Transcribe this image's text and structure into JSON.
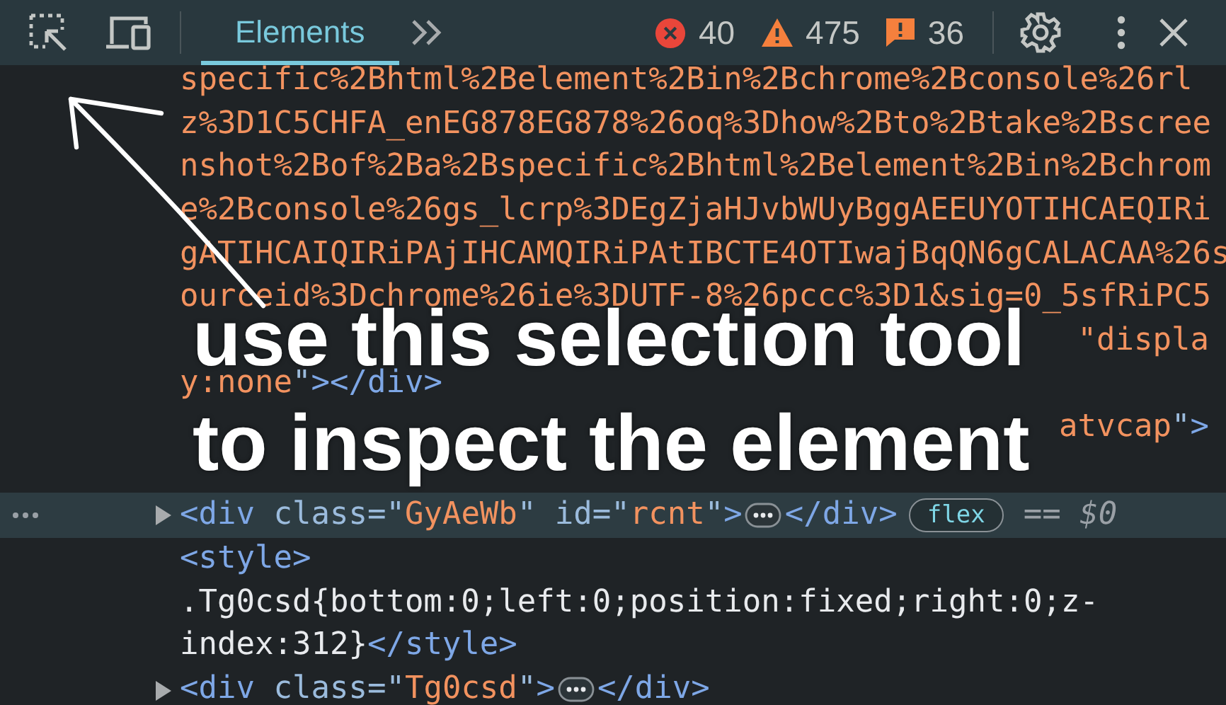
{
  "tabs": [
    {
      "label": "Elements",
      "selected": true
    }
  ],
  "counts": [
    {
      "kind": "error",
      "count": "40"
    },
    {
      "kind": "warning",
      "count": "475"
    },
    {
      "kind": "info",
      "count": "36"
    }
  ],
  "lines": [
    {
      "selected": false,
      "expander": false,
      "parts": [
        {
          "kind": "code",
          "tokens": [
            {
              "kind": "value",
              "t": "specific%2Bhtml%2Belement%2Bin%2Bchrome%2Bconsole%26rl"
            }
          ]
        }
      ]
    },
    {
      "selected": false,
      "expander": false,
      "parts": [
        {
          "kind": "code",
          "tokens": [
            {
              "kind": "value",
              "t": "z%3D1C5CHFA_enEG878EG878%26oq%3Dhow%2Bto%2Btake%2Bscree"
            }
          ]
        }
      ]
    },
    {
      "selected": false,
      "expander": false,
      "parts": [
        {
          "kind": "code",
          "tokens": [
            {
              "kind": "value",
              "t": "nshot%2Bof%2Ba%2Bspecific%2Bhtml%2Belement%2Bin%2Bchrom"
            }
          ]
        }
      ]
    },
    {
      "selected": false,
      "expander": false,
      "parts": [
        {
          "kind": "code",
          "tokens": [
            {
              "kind": "value",
              "t": "e%2Bconsole%26gs_lcrp%3DEgZjaHJvbWUyBggAEEUYOTIHCAEQIRi"
            }
          ]
        }
      ]
    },
    {
      "selected": false,
      "expander": false,
      "parts": [
        {
          "kind": "code",
          "tokens": [
            {
              "kind": "value",
              "t": "gATIHCAIQIRiPAjIHCAMQIRiPAtIBCTE4OTIwajBqQN6gCALACAA%26s"
            }
          ]
        }
      ]
    },
    {
      "selected": false,
      "expander": false,
      "parts": [
        {
          "kind": "code",
          "tokens": [
            {
              "kind": "value",
              "t": "ourceid%3Dchrome%26ie%3DUTF-8%26pccc%3D1&sig=0_5sfRiPC5"
            }
          ]
        }
      ]
    },
    {
      "selected": false,
      "expander": false,
      "covered": true,
      "parts": [
        {
          "kind": "code",
          "tokens": [
            {
              "kind": "value",
              "t": "\"displa"
            }
          ]
        }
      ]
    },
    {
      "selected": false,
      "expander": false,
      "parts": [
        {
          "kind": "code",
          "tokens": [
            {
              "kind": "value",
              "t": "y:none"
            },
            {
              "kind": "attr",
              "t": "\""
            },
            {
              "kind": "tag",
              "t": "></div>"
            }
          ]
        }
      ]
    },
    {
      "selected": false,
      "expander": false,
      "covered": true,
      "parts": [
        {
          "kind": "code",
          "tokens": [
            {
              "kind": "value",
              "t": "atvcap"
            },
            {
              "kind": "attr",
              "t": "\""
            },
            {
              "kind": "tag",
              "t": ">"
            }
          ]
        }
      ]
    },
    {
      "selected": false,
      "expander": false
    },
    {
      "selected": true,
      "expander": true,
      "parts": [
        {
          "kind": "code",
          "tokens": [
            {
              "kind": "tag",
              "t": "<div"
            },
            {
              "kind": "attr",
              "t": " class=\""
            },
            {
              "kind": "value",
              "t": "GyAeWb"
            },
            {
              "kind": "attr",
              "t": "\" id=\""
            },
            {
              "kind": "value",
              "t": "rcnt"
            },
            {
              "kind": "attr",
              "t": "\""
            },
            {
              "kind": "tag",
              "t": ">"
            }
          ]
        },
        {
          "kind": "ellipsis"
        },
        {
          "kind": "code",
          "tokens": [
            {
              "kind": "tag",
              "t": "</div>"
            }
          ]
        },
        {
          "kind": "badge",
          "text": "flex"
        },
        {
          "kind": "ref",
          "text": "== $0"
        }
      ]
    },
    {
      "selected": false,
      "expander": false,
      "parts": [
        {
          "kind": "code",
          "tokens": [
            {
              "kind": "tag",
              "t": "<style>"
            }
          ]
        }
      ]
    },
    {
      "selected": false,
      "expander": false,
      "parts": [
        {
          "kind": "code",
          "tokens": [
            {
              "kind": "text",
              "t": ".Tg0csd{bottom:0;left:0;position:fixed;right:0;z-"
            }
          ]
        }
      ]
    },
    {
      "selected": false,
      "expander": false,
      "parts": [
        {
          "kind": "code",
          "tokens": [
            {
              "kind": "text",
              "t": "index:312}"
            },
            {
              "kind": "tag",
              "t": "</style>"
            }
          ]
        }
      ]
    },
    {
      "selected": false,
      "expander": true,
      "parts": [
        {
          "kind": "code",
          "tokens": [
            {
              "kind": "tag",
              "t": "<div"
            },
            {
              "kind": "attr",
              "t": " class=\""
            },
            {
              "kind": "value",
              "t": "Tg0csd"
            },
            {
              "kind": "attr",
              "t": "\""
            },
            {
              "kind": "tag",
              "t": ">"
            }
          ]
        },
        {
          "kind": "ellipsis"
        },
        {
          "kind": "code",
          "tokens": [
            {
              "kind": "tag",
              "t": "</div>"
            }
          ]
        }
      ]
    }
  ],
  "annotation": {
    "lines": [
      "use this selection tool",
      "to inspect the element"
    ]
  }
}
